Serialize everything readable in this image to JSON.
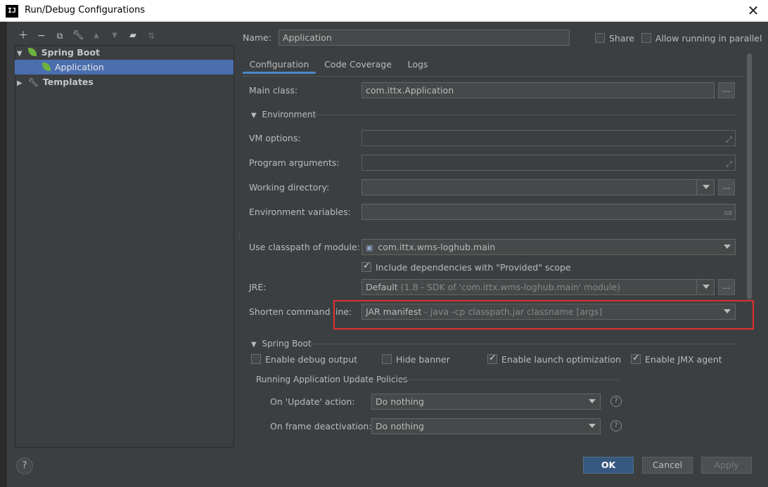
{
  "window": {
    "title": "Run/Debug Configurations",
    "logo": "IJ"
  },
  "toolbar": {
    "icons": [
      "add-icon",
      "remove-icon",
      "copy-icon",
      "wrench-icon",
      "move-up-icon",
      "move-down-icon",
      "folder-icon",
      "sort-icon"
    ]
  },
  "tree": {
    "items": [
      {
        "label": "Spring Boot"
      },
      {
        "label": "Application"
      },
      {
        "label": "Templates"
      }
    ]
  },
  "name": {
    "label": "Name:",
    "value": "Application"
  },
  "share": {
    "label": "Share",
    "checked": false
  },
  "parallel": {
    "label": "Allow running in parallel",
    "checked": false
  },
  "tabs": [
    {
      "label": "Configuration"
    },
    {
      "label": "Code Coverage"
    },
    {
      "label": "Logs"
    }
  ],
  "main_class": {
    "label": "Main class:",
    "value": "com.ittx.Application",
    "button": "..."
  },
  "environment": {
    "label": "Environment"
  },
  "vm_options": {
    "label": "VM options:",
    "value": ""
  },
  "program_args": {
    "label": "Program arguments:",
    "value": ""
  },
  "working_dir": {
    "label": "Working directory:",
    "value": "",
    "button": "..."
  },
  "env_vars": {
    "label": "Environment variables:",
    "value": ""
  },
  "classpath": {
    "label": "Use classpath of module:",
    "value": "com.ittx.wms-loghub.main"
  },
  "include_deps": {
    "label": "Include dependencies with \"Provided\" scope",
    "checked": true
  },
  "jre": {
    "label": "JRE:",
    "value_main": "Default",
    "value_detail": "(1.8 - SDK of 'com.ittx.wms-loghub.main' module)",
    "button": "..."
  },
  "shorten": {
    "label": "Shorten command line:",
    "value_main": "JAR manifest",
    "value_detail": "- java -cp classpath.jar classname [args]"
  },
  "spring_boot": {
    "label": "Spring Boot",
    "options": [
      {
        "label": "Enable debug output",
        "checked": false
      },
      {
        "label": "Hide banner",
        "checked": false
      },
      {
        "label": "Enable launch optimization",
        "checked": true
      },
      {
        "label": "Enable JMX agent",
        "checked": true
      }
    ],
    "policies_title": "Running Application Update Policies",
    "update_action": {
      "label": "On 'Update' action:",
      "value": "Do nothing"
    },
    "frame_deactivation": {
      "label": "On frame deactivation:",
      "value": "Do nothing"
    }
  },
  "footer": {
    "help": "?",
    "ok": "OK",
    "cancel": "Cancel",
    "apply": "Apply"
  },
  "colors": {
    "highlight": "#e03131",
    "selection": "#4b6eaf",
    "accent": "#4a88c7",
    "spring": "#6db33f"
  }
}
